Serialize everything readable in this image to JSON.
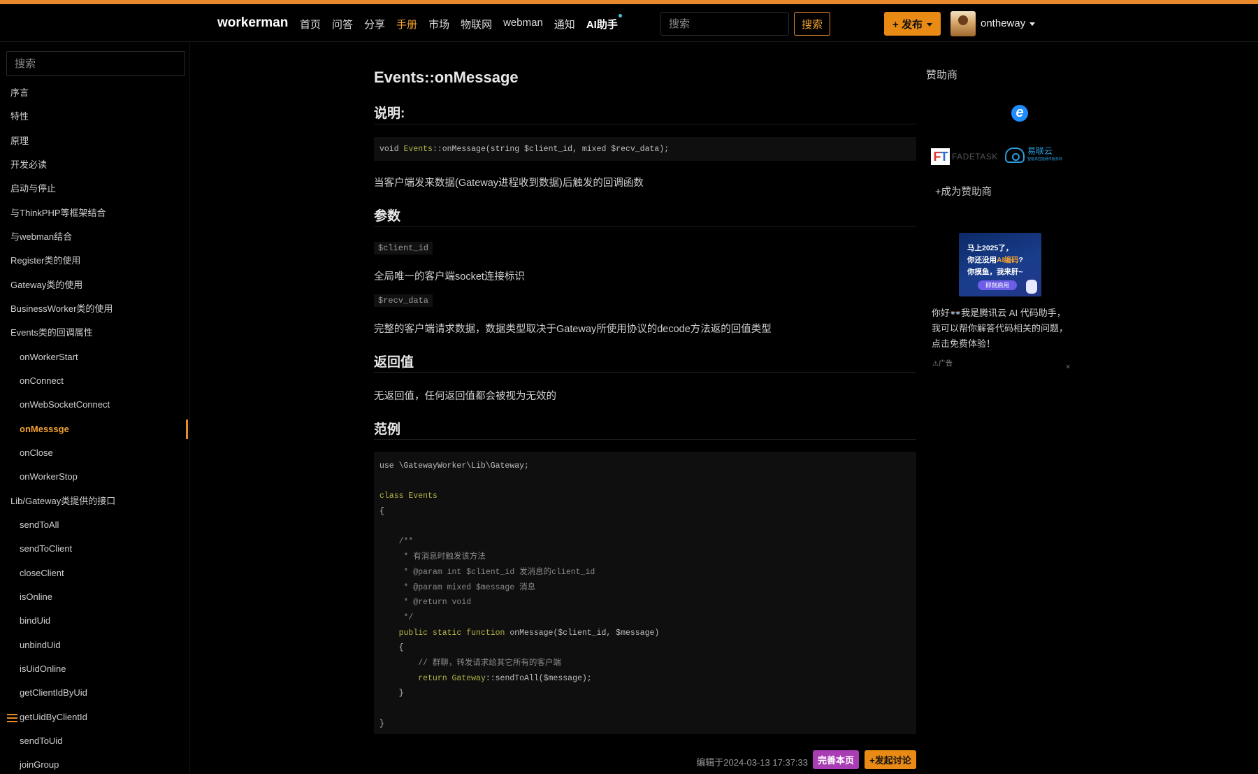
{
  "navbar": {
    "brand": "workerman",
    "links": [
      "首页",
      "问答",
      "分享",
      "手册",
      "市场",
      "物联网",
      "webman",
      "通知",
      "AI助手"
    ],
    "active_index": 3,
    "search_placeholder": "搜索",
    "search_button": "搜索",
    "publish_button": "+ 发布",
    "username": "ontheway"
  },
  "sidebar": {
    "search_placeholder": "搜索",
    "items": [
      {
        "label": "序言",
        "level": 0
      },
      {
        "label": "特性",
        "level": 0
      },
      {
        "label": "原理",
        "level": 0
      },
      {
        "label": "开发必读",
        "level": 0
      },
      {
        "label": "启动与停止",
        "level": 0
      },
      {
        "label": "与ThinkPHP等框架结合",
        "level": 0
      },
      {
        "label": "与webman结合",
        "level": 0
      },
      {
        "label": "Register类的使用",
        "level": 0
      },
      {
        "label": "Gateway类的使用",
        "level": 0
      },
      {
        "label": "BusinessWorker类的使用",
        "level": 0
      },
      {
        "label": "Events类的回调属性",
        "level": 0
      },
      {
        "label": "onWorkerStart",
        "level": 1
      },
      {
        "label": "onConnect",
        "level": 1
      },
      {
        "label": "onWebSocketConnect",
        "level": 1
      },
      {
        "label": "onMesssge",
        "level": 1,
        "active": true
      },
      {
        "label": "onClose",
        "level": 1
      },
      {
        "label": "onWorkerStop",
        "level": 1
      },
      {
        "label": "Lib/Gateway类提供的接口",
        "level": 0
      },
      {
        "label": "sendToAll",
        "level": 1
      },
      {
        "label": "sendToClient",
        "level": 1
      },
      {
        "label": "closeClient",
        "level": 1
      },
      {
        "label": "isOnline",
        "level": 1
      },
      {
        "label": "bindUid",
        "level": 1
      },
      {
        "label": "unbindUid",
        "level": 1
      },
      {
        "label": "isUidOnline",
        "level": 1
      },
      {
        "label": "getClientIdByUid",
        "level": 1
      },
      {
        "label": "getUidByClientId",
        "level": 1
      },
      {
        "label": "sendToUid",
        "level": 1
      },
      {
        "label": "joinGroup",
        "level": 1
      }
    ]
  },
  "main": {
    "title": "Events::onMessage",
    "section_desc": "说明:",
    "signature": {
      "prefix": "void ",
      "cls": "Events",
      "rest": "::onMessage(string $client_id, mixed $recv_data);"
    },
    "desc_text": "当客户端发来数据(Gateway进程收到数据)后触发的回调函数",
    "section_params": "参数",
    "param1_code": "$client_id",
    "param1_desc": "全局唯一的客户端socket连接标识",
    "param2_code": "$recv_data",
    "param2_desc": "完整的客户端请求数据，数据类型取决于Gateway所使用协议的decode方法返的回值类型",
    "section_return": "返回值",
    "return_text": "无返回值，任何返回值都会被视为无效的",
    "section_example": "范例",
    "code_lines": [
      {
        "text": "use \\GatewayWorker\\Lib\\Gateway;",
        "kind": "normal"
      },
      {
        "text": "",
        "kind": "normal"
      },
      {
        "text": "class Events",
        "kind": "class"
      },
      {
        "text": "{",
        "kind": "normal"
      },
      {
        "text": "",
        "kind": "normal"
      },
      {
        "text": "    /**",
        "kind": "comment"
      },
      {
        "text": "     * 有消息时触发该方法",
        "kind": "comment"
      },
      {
        "text": "     * @param int $client_id 发消息的client_id",
        "kind": "comment"
      },
      {
        "text": "     * @param mixed $message 消息",
        "kind": "comment"
      },
      {
        "text": "     * @return void",
        "kind": "comment"
      },
      {
        "text": "     */",
        "kind": "comment"
      },
      {
        "text": "    public static function onMessage($client_id, $message)",
        "kind": "func"
      },
      {
        "text": "    {",
        "kind": "normal"
      },
      {
        "text": "        // 群聊，转发请求给其它所有的客户端",
        "kind": "comment"
      },
      {
        "text": "        return Gateway::sendToAll($message);",
        "kind": "return"
      },
      {
        "text": "    }",
        "kind": "normal"
      },
      {
        "text": "",
        "kind": "normal"
      },
      {
        "text": "}",
        "kind": "normal"
      }
    ],
    "edited": "编辑于2024-03-13 17:37:33",
    "improve_button": "完善本页",
    "discuss_button": "+发起讨论"
  },
  "right": {
    "sponsor_title": "赞助商",
    "sponsor1_text": "FADETASK",
    "sponsor2_text": "易联云",
    "sponsor2_sub": "智能高性能硬件服务商",
    "become_sponsor": "+成为赞助商",
    "ad_headline1": "马上2025了，",
    "ad_headline2_pre": "你还没用",
    "ad_headline2_hl": "AI编码",
    "ad_headline2_post": "?",
    "ad_headline3": "你摸鱼，我来肝~",
    "ad_cta": "即刻启用",
    "ad_text": "你好👓我是腾讯云 AI 代码助手，我可以帮你解答代码相关的问题，点击免费体验！",
    "ad_label": "广告",
    "ad_close": "×"
  },
  "colors": {
    "accent": "#e8892c",
    "purple_button": "#a93db4",
    "background": "#000000"
  }
}
